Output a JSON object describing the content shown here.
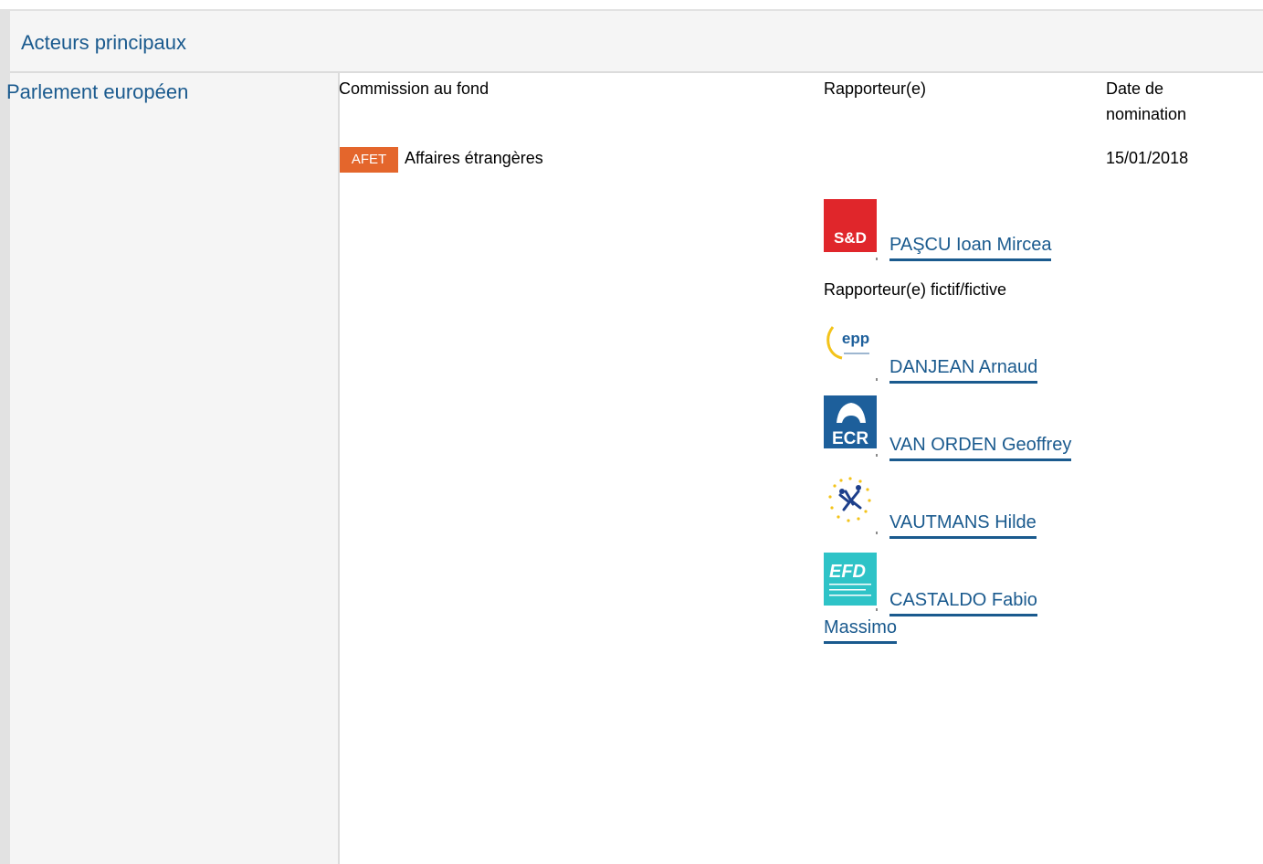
{
  "header": {
    "title": "Acteurs principaux"
  },
  "institution": "Parlement européen",
  "table": {
    "col_committee": "Commission au fond",
    "col_rapporteur": "Rapporteur(e)",
    "col_date_line1": "Date de",
    "col_date_line2": "nomination"
  },
  "committee": {
    "badge": "AFET",
    "name": "Affaires étrangères",
    "date": "15/01/2018"
  },
  "rapporteur": {
    "name": "PAŞCU Ioan Mircea",
    "group_logo": "s&d-logo"
  },
  "shadow_label": "Rapporteur(e) fictif/fictive",
  "shadows": [
    {
      "name": "DANJEAN Arnaud",
      "group_logo": "epp-logo"
    },
    {
      "name": "VAN ORDEN Geoffrey",
      "group_logo": "ecr-logo"
    },
    {
      "name": "VAUTMANS Hilde",
      "group_logo": "alde-logo"
    },
    {
      "name_line1": "CASTALDO Fabio",
      "name_line2": "Massimo",
      "group_logo": "efdd-logo"
    }
  ],
  "logo_text": {
    "sd": "S&D",
    "epp": "epp",
    "ecr": "ECR",
    "efd": "EFD"
  },
  "colors": {
    "link": "#1a5a8e",
    "badge": "#e4662c",
    "sd": "#e0262b",
    "ecr": "#1d5f9b",
    "efd": "#2ec3c7"
  }
}
